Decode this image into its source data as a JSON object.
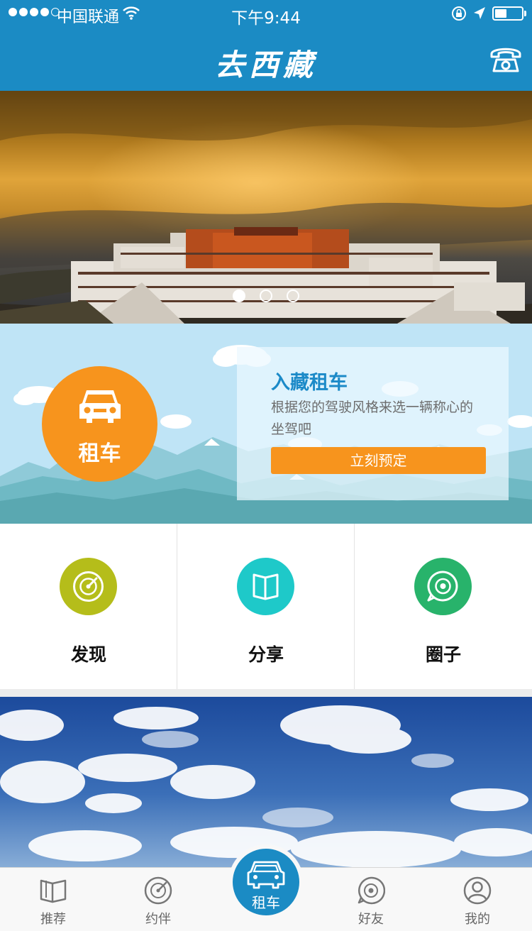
{
  "status_bar": {
    "carrier": "中国联通",
    "time": "下午9:44",
    "battery_level": 0.45
  },
  "header": {
    "title": "去西藏",
    "phone_icon": "phone-icon"
  },
  "banner": {
    "slide_count": 3,
    "active_slide": 1
  },
  "rental": {
    "badge_label": "租车",
    "promo_title": "入藏租车",
    "promo_desc": "根据您的驾驶风格来选一辆称心的坐驾吧",
    "promo_button": "立刻预定"
  },
  "features": [
    {
      "label": "发现",
      "icon": "compass-icon",
      "color": "#b5bd1a"
    },
    {
      "label": "分享",
      "icon": "book-icon",
      "color": "#1ec9c9"
    },
    {
      "label": "圈子",
      "icon": "chat-ring-icon",
      "color": "#28b36b"
    }
  ],
  "tabbar": {
    "tabs": [
      {
        "label": "推荐",
        "icon": "book-icon"
      },
      {
        "label": "约伴",
        "icon": "compass-icon"
      },
      {
        "label": "租车",
        "icon": "car-icon",
        "active": true
      },
      {
        "label": "好友",
        "icon": "chat-ring-icon"
      },
      {
        "label": "我的",
        "icon": "person-icon"
      }
    ]
  },
  "colors": {
    "brand_blue": "#1b8bc4",
    "accent_orange": "#f7941d"
  }
}
